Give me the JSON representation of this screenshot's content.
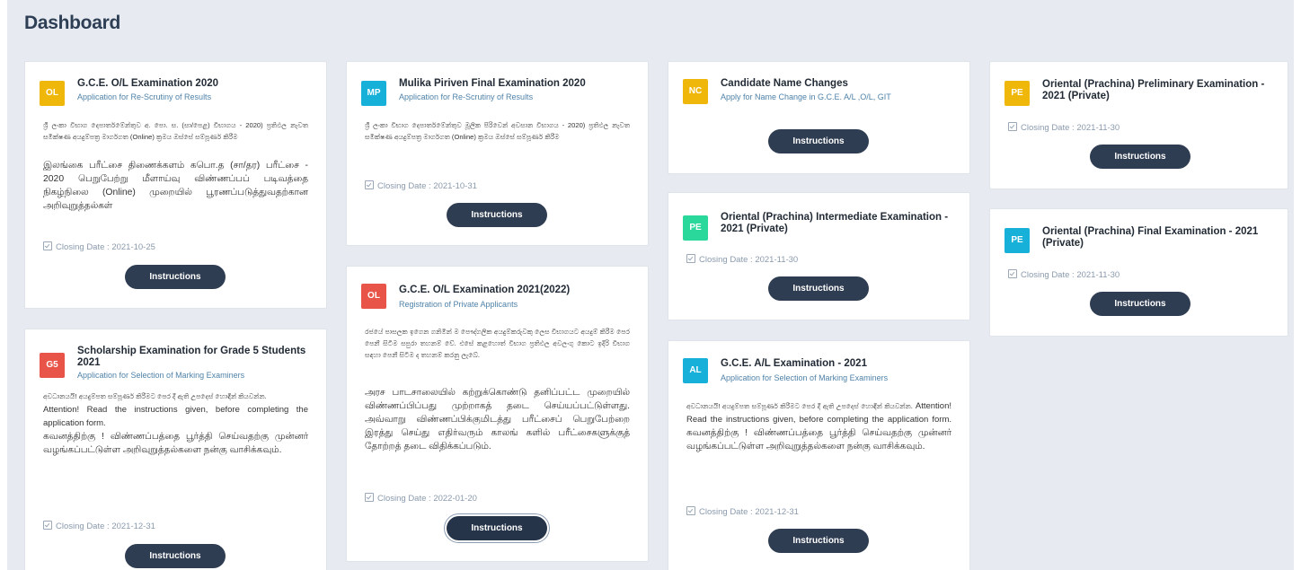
{
  "header": {
    "title": "Dashboard"
  },
  "colors": {
    "page_bg": "#e7ebf1",
    "button": "#2f3d52",
    "badge_yellow": "#f0b70b",
    "badge_cyan": "#17b0d9",
    "badge_red": "#e85548",
    "badge_green": "#2bd89b",
    "subtitle": "#4f82a8"
  },
  "closing_prefix": "Closing Date : ",
  "button_label": "Instructions",
  "cards": {
    "ol2020": {
      "badge": "OL",
      "title": "G.C.E. O/L Examination 2020",
      "subtitle": "Application for Re-Scrutiny of Results",
      "desc_si": "ශ්‍රී ලංකා විභාග දෙපාර්තමේන්තුව අ. පො. ස. (සා/පෙළ) විභාගය - 2020) ප්‍රතිඵල නැවත සමීක්ෂණ අයදුම්පත්‍ර මාර්ගගත (Online) ක්‍රමය ඔස්සේ සම්පූර්ණ කිරීම",
      "desc_ta": "இலங்கை பரீட்சை திணைக்களம் கபொ.த (சா/தர) பரீட்சை - 2020 பெறுபேற்று மீளாய்வு விண்ணப்பப் படிவத்தை நிகழ்நிலை (Online) முறையில் பூரணப்படுத்துவதற்கான அறிவுறுத்தல்கள்",
      "closing_date": "2021-10-25"
    },
    "mp2020": {
      "badge": "MP",
      "title": "Mulika Piriven Final Examination 2020",
      "subtitle": "Application for Re-Scrutiny of Results",
      "desc_si": "ශ්‍රී ලංකා විභාග දෙපාර්තමේන්තුව මූලික පිරිවෙන් අවසාන විභාගය - 2020) ප්‍රතිඵල නැවත සමීක්ෂණ අයදුම්පත්‍ර මාර්ගගත (Online) ක්‍රමය ඔස්සේ සම්පූර්ණ කිරීම",
      "closing_date": "2021-10-31"
    },
    "ol2021": {
      "badge": "OL",
      "title": "G.C.E. O/L Examination 2021(2022)",
      "subtitle": "Registration of Private Applicants",
      "desc_si": "රජයේ පාසලක ඉගෙන ගනිමින් ම පෞද්ගලික අයදුම්කරුවකු ලෙස විභාගයට අයදුම් කිරීම පෙර පෙනී සිටීම සපුරා තහනම් වේ. එසේ කළහොත් විභාග ප්‍රතිඵල අවලංගු කොට ඉදිරි විභාග සඳහා පෙනී සිටීම ද තහනම් කරනු ලැබේ.",
      "desc_ta": "அரச பாடசாலையில் கற்றுக்கொண்டு தனிப்பட்ட முறையில் விண்ணப்பிப்பது முற்றாகத் தடை செய்யப்பட்டுள்ளது. அவ்வாறு விண்ணப்பிக்குமிடத்து பரீட்சைப் பெறுபேற்றை இரத்து செய்து எதிர்வரும் காலங் களில் பரீட்சைகளுக்குத் தோற்றத் தடை விதிக்கப்படும்.",
      "closing_date": "2022-01-20"
    },
    "nc": {
      "badge": "NC",
      "title": "Candidate Name Changes",
      "subtitle": "Apply for Name Change in G.C.E. A/L ,O/L, GIT"
    },
    "pe_intermediate": {
      "badge": "PE",
      "title": "Oriental (Prachina) Intermediate Examination - 2021 (Private)",
      "closing_date": "2021-11-30"
    },
    "al2021": {
      "badge": "AL",
      "title": "G.C.E. A/L Examination - 2021",
      "subtitle": "Application for Selection of Marking Examiners",
      "desc_si": "අවධානයයි! අයදුම්පත සම්පූර්ණ කිරීමට පෙර දී ඇති උපදෙස් හොඳින් කියවන්න.",
      "desc_en": " Attention! Read the instructions given, before completing the application form. ",
      "desc_ta": "கவனத்திற்கு ! விண்ணப்பத்தை பூர்த்தி செய்வதற்கு முன்னர் வழங்கப்பட்டுள்ள அறிவுறுத்தல்களை நன்கு வாசிக்கவும்.",
      "closing_date": "2021-12-31"
    },
    "pe_preliminary": {
      "badge": "PE",
      "title": "Oriental (Prachina) Preliminary Examination - 2021 (Private)",
      "closing_date": "2021-11-30"
    },
    "pe_final": {
      "badge": "PE",
      "title": "Oriental (Prachina) Final Examination - 2021 (Private)",
      "closing_date": "2021-11-30"
    },
    "g5": {
      "badge": "G5",
      "title": "Scholarship Examination for Grade 5 Students 2021",
      "subtitle": "Application for Selection of Marking Examiners",
      "desc_si": "අවධානයයි! අයදුම්පත සම්පූර්ණ කිරීමට පෙර දී ඇති උපදෙස් හොඳින් කියවන්න.",
      "desc_en": "Attention! Read the instructions given, before completing the application form.",
      "desc_ta": "கவனத்திற்கு ! விண்ணப்பத்தை பூர்த்தி செய்வதற்கு முன்னர் வழங்கப்பட்டுள்ள அறிவுறுத்தல்களை நன்கு வாசிக்கவும்.",
      "closing_date": "2021-12-31"
    }
  }
}
